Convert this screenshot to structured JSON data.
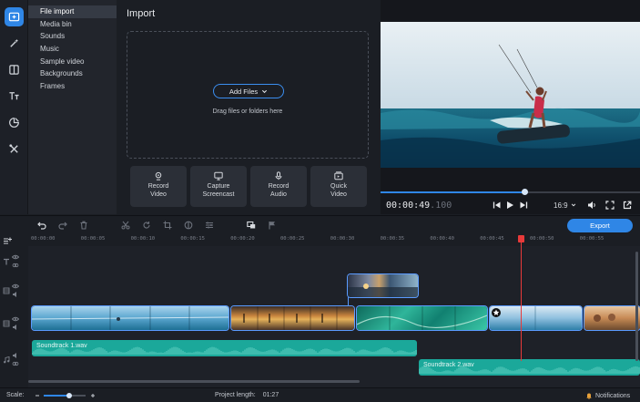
{
  "sidebar": {
    "categories": [
      "File import",
      "Media bin",
      "Sounds",
      "Music",
      "Sample video",
      "Backgrounds",
      "Frames"
    ]
  },
  "import": {
    "title": "Import",
    "add_files_label": "Add Files",
    "drop_hint": "Drag files or folders here",
    "buttons": [
      {
        "line1": "Record",
        "line2": "Video",
        "icon": "webcam-icon"
      },
      {
        "line1": "Capture",
        "line2": "Screencast",
        "icon": "monitor-icon"
      },
      {
        "line1": "Record",
        "line2": "Audio",
        "icon": "microphone-icon"
      },
      {
        "line1": "Quick",
        "line2": "Video",
        "icon": "quick-video-icon"
      }
    ]
  },
  "preview": {
    "timecode_main": "00:00:49",
    "timecode_frac": ".100",
    "aspect_ratio": "16:9",
    "progress_fraction": 0.555
  },
  "toolbar": {
    "export_label": "Export"
  },
  "timeline": {
    "ticks": [
      "00:00:00",
      "00:00:05",
      "00:00:10",
      "00:00:15",
      "00:00:20",
      "00:00:25",
      "00:00:30",
      "00:00:35",
      "00:00:40",
      "00:00:45",
      "00:00:50",
      "00:00:55"
    ],
    "audio_tracks": [
      "Soundtrack 1.wav",
      "Soundtrack 2.wav"
    ]
  },
  "status": {
    "scale_label": "Scale:",
    "project_length_label": "Project length:",
    "project_length_value": "01:27",
    "notifications_label": "Notifications"
  },
  "colors": {
    "accent": "#2f86e6",
    "audio": "#1ba89a",
    "playhead": "#e83a3a"
  }
}
